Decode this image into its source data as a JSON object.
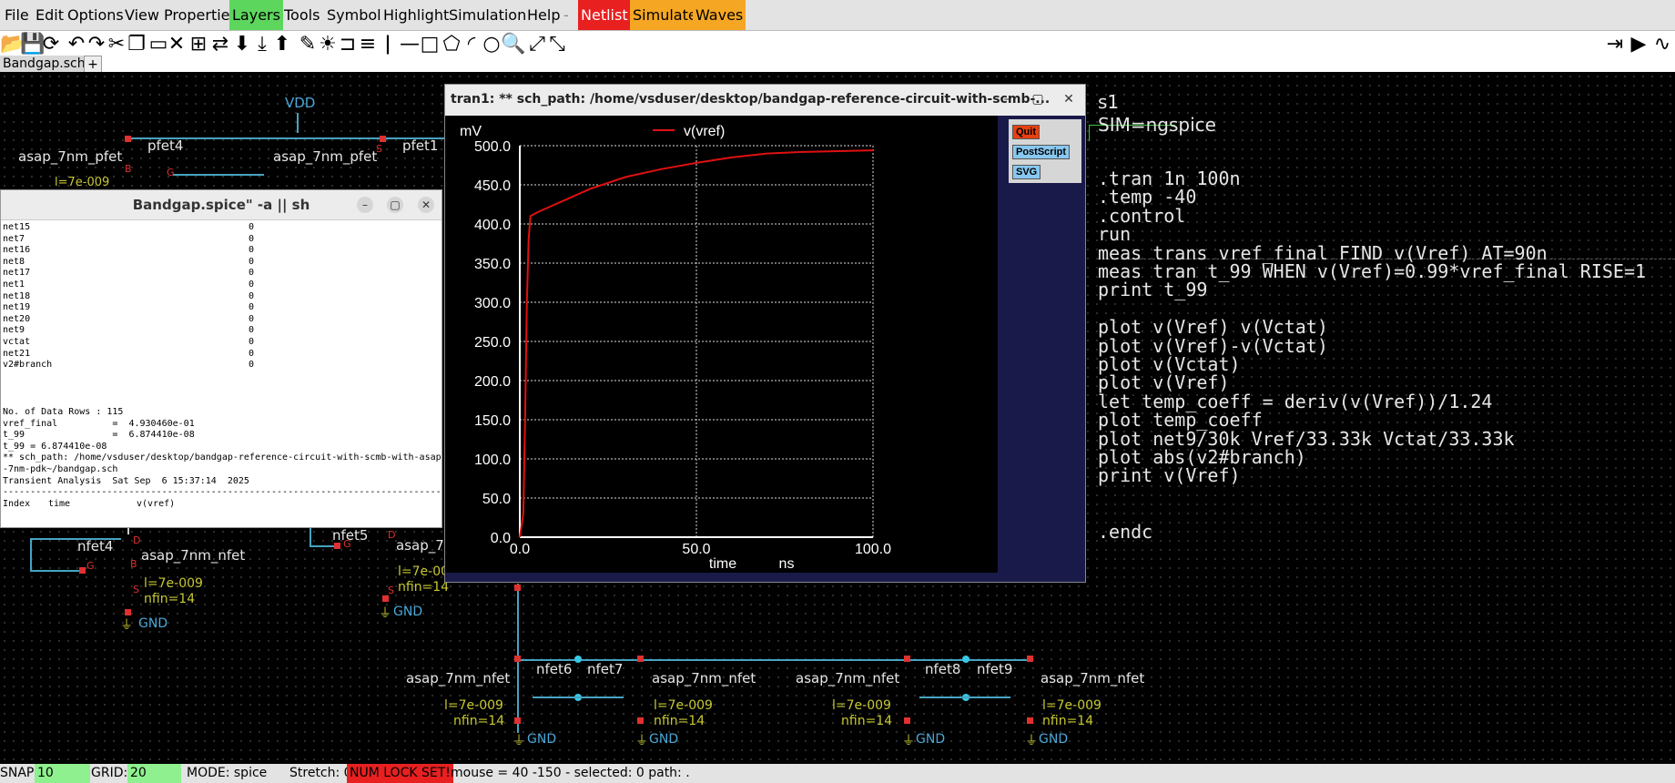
{
  "menu": {
    "items": [
      "File",
      "Edit",
      "Options",
      "View",
      "Properties",
      "Layers",
      "Tools",
      "Symbol",
      "Highlight",
      "Simulation",
      "Help",
      "-",
      "Netlist",
      "Simulate",
      "Waves"
    ],
    "colors": {
      "layers": "#5dd65d",
      "netlist": "#e82020",
      "simulate": "#f5a623",
      "waves": "#f5a623"
    }
  },
  "toolbar": {
    "icons": [
      "open-icon",
      "save-icon",
      "reload-icon",
      "undo-icon",
      "redo-icon",
      "cut-icon",
      "copy-icon",
      "paste-icon",
      "delete-icon",
      "insert-symbol-icon",
      "flip-icon",
      "move-down-icon",
      "push-icon",
      "pop-icon",
      "brush-icon",
      "highlight-icon",
      "netlabel-icon",
      "text-icon",
      "pin-icon",
      "line-icon",
      "rect-icon",
      "polygon-icon",
      "arc-icon",
      "circle-icon",
      "zoom-icon",
      "fullscreen-icon",
      "zoom-fit-icon"
    ],
    "right_icons": [
      "netlist-run-icon",
      "play-icon",
      "waves-icon"
    ]
  },
  "tabs": {
    "active": "Bandgap.sch*",
    "plus": "+"
  },
  "schematic": {
    "vdd_label": "VDD",
    "pfet4": {
      "name": "pfet4",
      "model": "asap_7nm_pfet",
      "l": "l=7e-009"
    },
    "pfet1": {
      "name": "pfet1",
      "model": "asap_7nm_pfet"
    },
    "nfet4": {
      "name": "nfet4",
      "model": "asap_7nm_nfet",
      "l": "l=7e-009",
      "nfin": "nfin=14"
    },
    "nfet5": {
      "name": "nfet5",
      "model": "asap_7n",
      "l": "l=7e-00",
      "nfin": "nfin=14"
    },
    "nfet6": {
      "name": "nfet6",
      "model": "asap_7nm_nfet",
      "l": "l=7e-009",
      "nfin": "nfin=14"
    },
    "nfet7": {
      "name": "nfet7",
      "model": "asap_7nm_nfet",
      "l": "l=7e-009",
      "nfin": "nfin=14"
    },
    "nfet8": {
      "name": "nfet8",
      "model": "asap_7nm_nfet",
      "l": "l=7e-009",
      "nfin": "nfin=14"
    },
    "nfet9": {
      "name": "nfet9",
      "model": "asap_7nm_nfet",
      "l": "l=7e-009",
      "nfin": "nfin=14"
    },
    "gnd": "GND",
    "pin_g": "G",
    "pin_d": "D",
    "pin_s": "S",
    "pin_b": "B"
  },
  "netlist": {
    "s1": "s1",
    "sim": "SIM=ngspice",
    "lines": [
      ".tran 1n 100n",
      ".temp -40",
      ".control",
      "run",
      "meas trans vref_final FIND v(Vref) AT=90n",
      "meas tran t_99 WHEN v(Vref)=0.99*vref_final RISE=1",
      "print t_99",
      "",
      "plot v(Vref) v(Vctat)",
      "plot v(Vref)-v(Vctat)",
      "plot v(Vctat)",
      "plot v(Vref)",
      "let temp_coeff = deriv(v(Vref))/1.24",
      "plot temp_coeff",
      "plot net9/30k Vref/33.33k Vctat/33.33k",
      "plot abs(v2#branch)",
      "print v(Vref)",
      "",
      "",
      ".endc"
    ]
  },
  "terminal": {
    "title": "Bandgap.spice\" -a || sh",
    "nets": [
      [
        "net15",
        "0"
      ],
      [
        "net7",
        "0"
      ],
      [
        "net16",
        "0"
      ],
      [
        "net8",
        "0"
      ],
      [
        "net17",
        "0"
      ],
      [
        "net1",
        "0"
      ],
      [
        "net18",
        "0"
      ],
      [
        "net19",
        "0"
      ],
      [
        "net20",
        "0"
      ],
      [
        "net9",
        "0"
      ],
      [
        "vctat",
        "0"
      ],
      [
        "net21",
        "0"
      ],
      [
        "v2#branch",
        "0"
      ]
    ],
    "rows_label": "No. of Data Rows : 115",
    "vref_final": "vref_final          =  4.930460e-01",
    "t99_line": "t_99                =  6.874410e-08",
    "t99_eq": "t_99 = 6.874410e-08",
    "sch_path": "** sch_path: /home/vsduser/desktop/bandgap-reference-circuit-with-scmb-with-asap",
    "sch_path2": "-7nm-pdk~/bandgap.sch",
    "analysis": "Transient Analysis  Sat Sep  6 15:37:14  2025",
    "divider": "--------------------------------------------------------------------------------",
    "col_index": "Index",
    "col_time": "time",
    "col_vref": "v(vref)"
  },
  "plotwindow": {
    "title": "tran1: ** sch_path: /home/vsduser/desktop/bandgap-reference-circuit-with-scmb-...",
    "buttons": {
      "quit": "Quit",
      "postscript": "PostScript",
      "svg": "SVG"
    }
  },
  "chart_data": {
    "type": "line",
    "ylabel_unit": "mV",
    "xlabel": "time",
    "xunit": "ns",
    "legend": "v(vref)",
    "legend_position": "top-center",
    "series_color": "#e01010",
    "xlim": [
      0,
      100
    ],
    "ylim": [
      0,
      500
    ],
    "xticks": [
      "0.0",
      "50.0",
      "100.0"
    ],
    "yticks": [
      "0.0",
      "50.0",
      "100.0",
      "150.0",
      "200.0",
      "250.0",
      "300.0",
      "350.0",
      "400.0",
      "450.0",
      "500.0"
    ],
    "grid": true,
    "series": [
      {
        "name": "v(vref)",
        "x": [
          0,
          1,
          1.5,
          2,
          2.5,
          3,
          5,
          10,
          15,
          20,
          30,
          40,
          50,
          60,
          70,
          80,
          90,
          100
        ],
        "y": [
          0,
          30,
          150,
          300,
          380,
          410,
          415,
          425,
          435,
          445,
          460,
          470,
          478,
          485,
          490,
          492,
          493,
          494
        ]
      }
    ]
  },
  "statusbar": {
    "snap_label": "SNAP:",
    "snap": "10",
    "grid_label": "GRID:",
    "grid": "20",
    "mode": "MODE:    spice",
    "stretch": "Stretch: 0",
    "numlock": "NUM LOCK SET!",
    "info": "mouse = 40 -150 - selected: 0 path: ."
  }
}
